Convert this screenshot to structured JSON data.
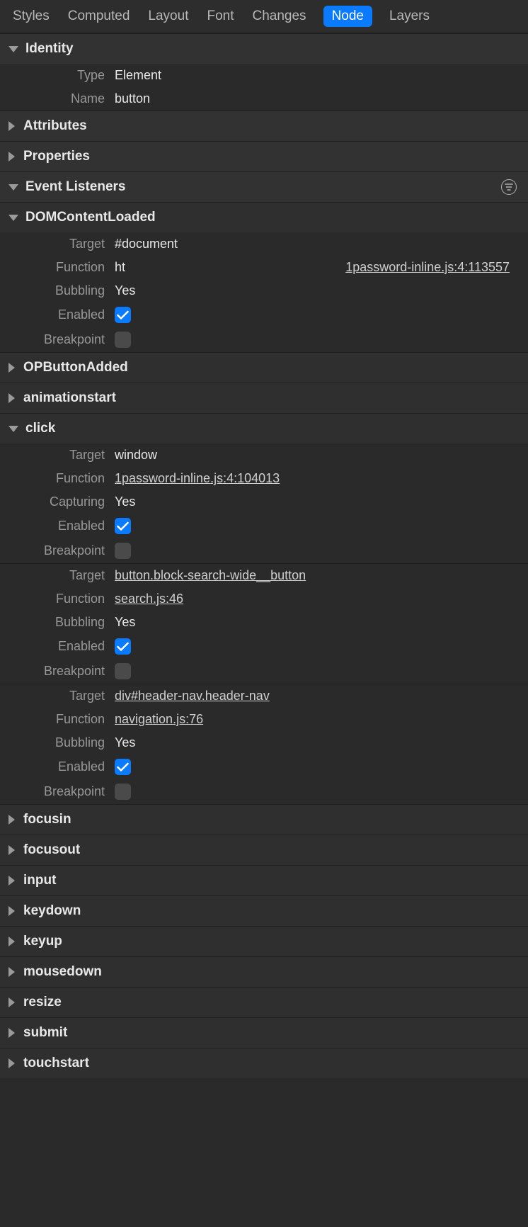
{
  "tabs": [
    "Styles",
    "Computed",
    "Layout",
    "Font",
    "Changes",
    "Node",
    "Layers"
  ],
  "activeTab": "Node",
  "sections": {
    "identity": {
      "title": "Identity",
      "rows": {
        "type_label": "Type",
        "type_value": "Element",
        "name_label": "Name",
        "name_value": "button"
      }
    },
    "attributes": "Attributes",
    "properties": "Properties",
    "eventListeners": "Event Listeners",
    "listeners": {
      "domcontentloaded": {
        "name": "DOMContentLoaded",
        "items": [
          {
            "target_label": "Target",
            "target": "#document",
            "function_label": "Function",
            "function": "ht",
            "source": "1password-inline.js:4:113557",
            "bubbling_label": "Bubbling",
            "bubbling": "Yes",
            "enabled_label": "Enabled",
            "enabled": true,
            "breakpoint_label": "Breakpoint",
            "breakpoint": false
          }
        ]
      },
      "opbuttonadded": "OPButtonAdded",
      "animationstart": "animationstart",
      "click": {
        "name": "click",
        "items": [
          {
            "target_label": "Target",
            "target": "window",
            "function_label": "Function",
            "function_link": "1password-inline.js:4:104013",
            "capturing_label": "Capturing",
            "capturing": "Yes",
            "enabled_label": "Enabled",
            "enabled": true,
            "breakpoint_label": "Breakpoint",
            "breakpoint": false
          },
          {
            "target_label": "Target",
            "target_link": "button.block-search-wide__button",
            "function_label": "Function",
            "function_link": "search.js:46",
            "bubbling_label": "Bubbling",
            "bubbling": "Yes",
            "enabled_label": "Enabled",
            "enabled": true,
            "breakpoint_label": "Breakpoint",
            "breakpoint": false
          },
          {
            "target_label": "Target",
            "target_link": "div#header-nav.header-nav",
            "function_label": "Function",
            "function_link": "navigation.js:76",
            "bubbling_label": "Bubbling",
            "bubbling": "Yes",
            "enabled_label": "Enabled",
            "enabled": true,
            "breakpoint_label": "Breakpoint",
            "breakpoint": false
          }
        ]
      },
      "focusin": "focusin",
      "focusout": "focusout",
      "input": "input",
      "keydown": "keydown",
      "keyup": "keyup",
      "mousedown": "mousedown",
      "resize": "resize",
      "submit": "submit",
      "touchstart": "touchstart"
    }
  }
}
